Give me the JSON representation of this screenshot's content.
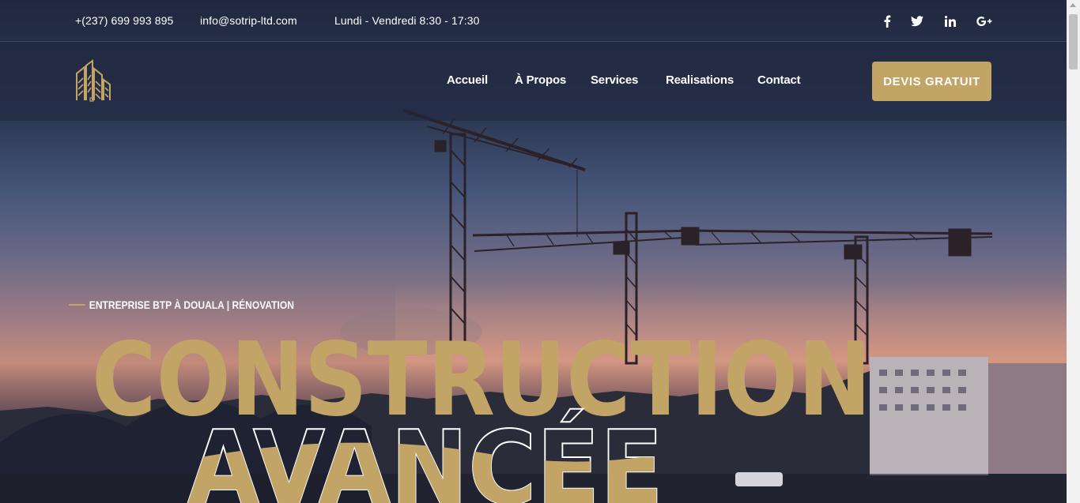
{
  "topbar": {
    "phone": "+(237) 699 993 895",
    "email": "info@sotrip-ltd.com",
    "hours": "Lundi - Vendredi 8:30 - 17:30",
    "social": [
      "facebook-icon",
      "twitter-icon",
      "linkedin-icon",
      "google-plus-icon"
    ]
  },
  "header": {
    "nav": [
      "Accueil",
      "À Propos",
      "Services",
      "Realisations",
      "Contact"
    ],
    "cta_label": "DEVIS GRATUIT"
  },
  "hero": {
    "tagline": "ENTREPRISE BTP À DOUALA | RÉNOVATION",
    "title_line1": "CONSTRUCTION",
    "title_line2": "AVANCÉE"
  },
  "colors": {
    "accent": "#c2a566",
    "navy": "#1e2540",
    "text": "#ffffff"
  }
}
